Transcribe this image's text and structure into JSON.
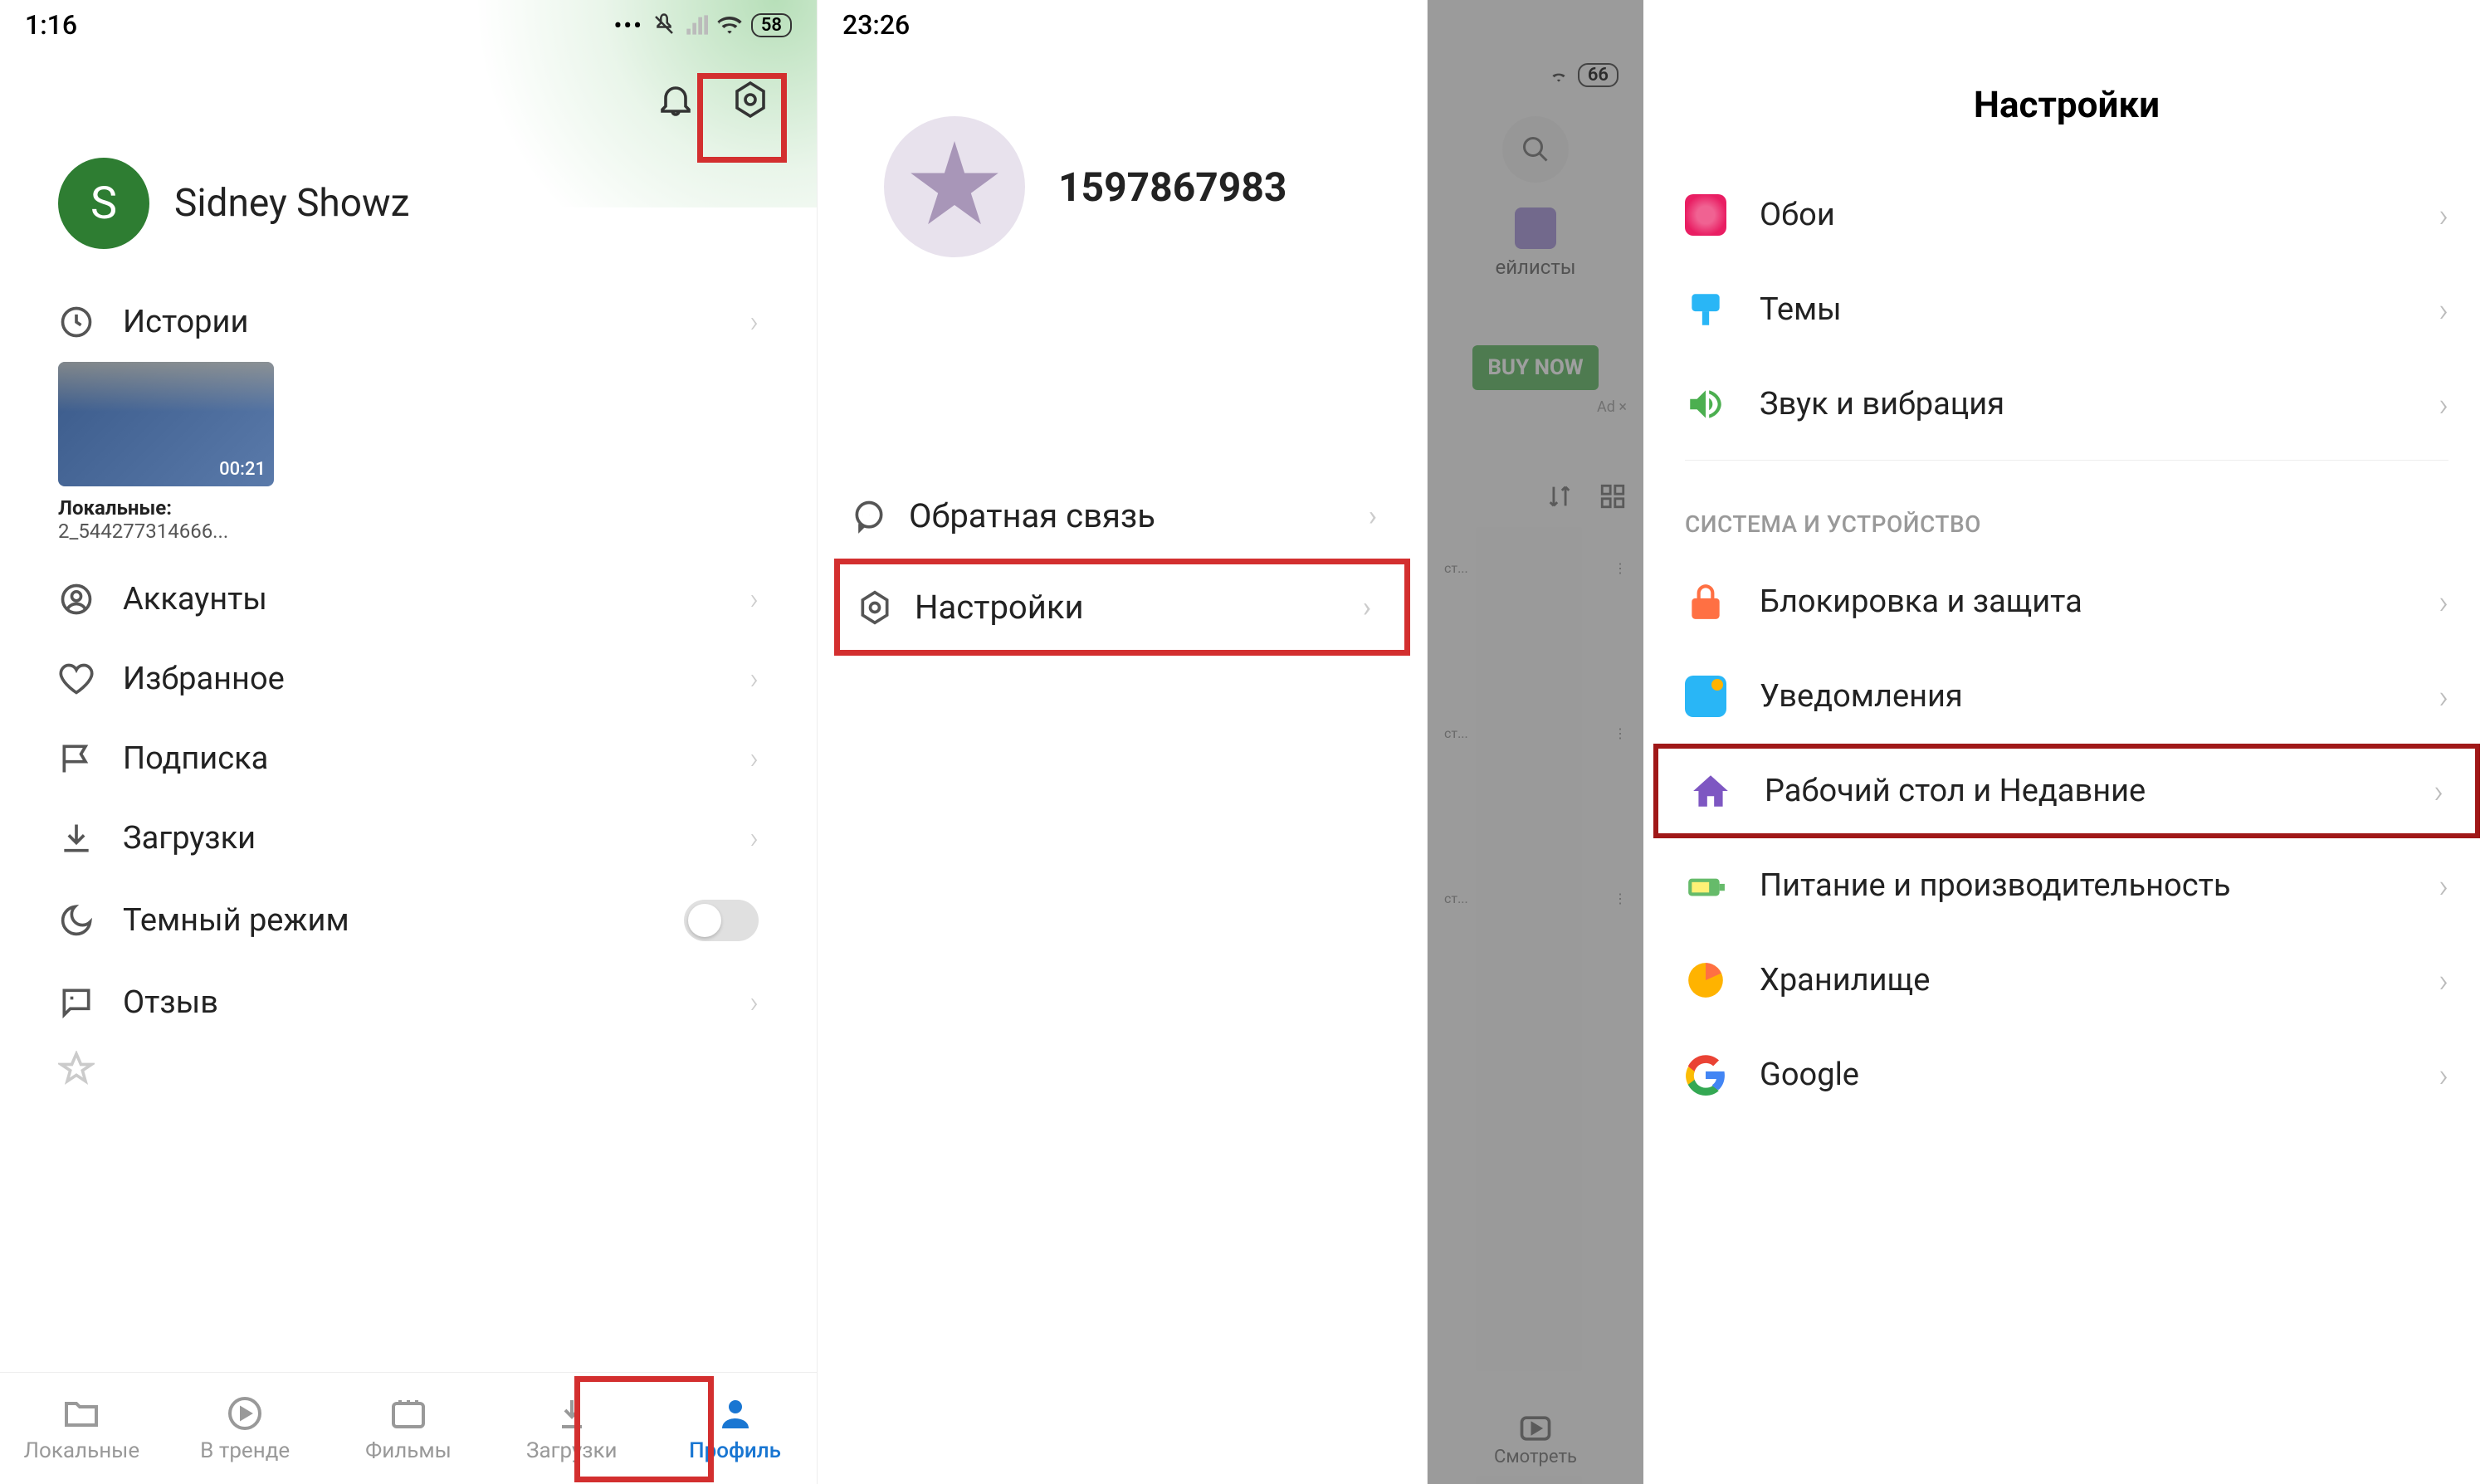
{
  "screen1": {
    "status": {
      "time": "1:16",
      "battery": "58"
    },
    "profile": {
      "initial": "S",
      "name": "Sidney Showz"
    },
    "menu": {
      "history": "Истории",
      "accounts": "Аккаунты",
      "favorites": "Избранное",
      "subscription": "Подписка",
      "downloads": "Загрузки",
      "dark_mode": "Темный режим",
      "review": "Отзыв"
    },
    "story": {
      "duration": "00:21",
      "title": "Локальные:",
      "sub": "2_544277314666..."
    },
    "nav": {
      "local": "Локальные",
      "trending": "В тренде",
      "movies": "Фильмы",
      "downloads": "Загрузки",
      "profile": "Профиль"
    }
  },
  "screen2": {
    "status": {
      "time": "23:26"
    },
    "profile": {
      "name": "1597867983"
    },
    "menu": {
      "feedback": "Обратная связь",
      "settings": "Настройки"
    }
  },
  "screen3bg": {
    "status": {
      "battery": "66"
    },
    "playlists": "ейлисты",
    "buy": "BUY NOW",
    "ad": "Ad ×",
    "item": "ст...",
    "watch": "Смотреть"
  },
  "screen3": {
    "title": "Настройки",
    "section1": {
      "wallpaper": "Обои",
      "themes": "Темы",
      "sound": "Звук и вибрация"
    },
    "section_header": "СИСТЕМА И УСТРОЙСТВО",
    "section2": {
      "lock": "Блокировка и защита",
      "notifications": "Уведомления",
      "home": "Рабочий стол и Недавние",
      "battery": "Питание и производительность",
      "storage": "Хранилище",
      "google": "Google"
    }
  }
}
